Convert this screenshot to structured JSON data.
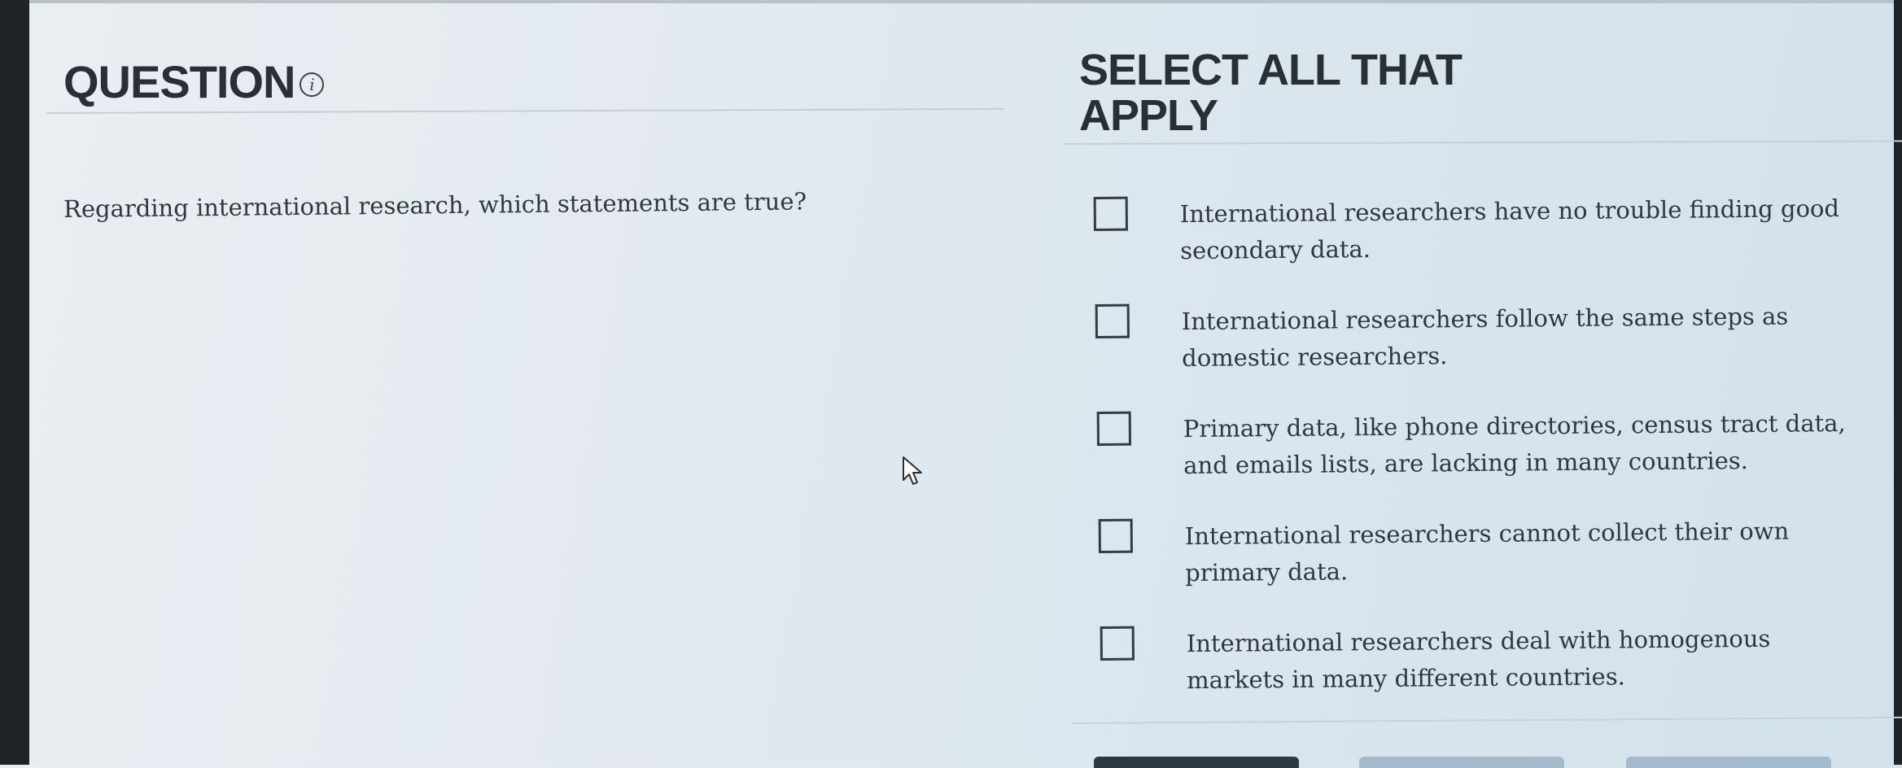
{
  "question": {
    "title": "QUESTION",
    "info_icon": "info-icon",
    "text": "Regarding international research, which statements are true?"
  },
  "answers": {
    "title": "SELECT ALL THAT APPLY",
    "options": [
      {
        "label": "International researchers have no trouble finding good secondary data.",
        "checked": false
      },
      {
        "label": "International researchers follow the same steps as domestic researchers.",
        "checked": false
      },
      {
        "label": "Primary data, like phone directories, census tract data, and emails lists, are lacking in many countries.",
        "checked": false
      },
      {
        "label": "International researchers cannot collect their own primary data.",
        "checked": false
      },
      {
        "label": "International researchers deal with homogenous markets in many different countries.",
        "checked": false
      }
    ]
  },
  "colors": {
    "primary_button": "#2d3845",
    "secondary_button": "#a4bacb",
    "text": "#2f3741"
  }
}
